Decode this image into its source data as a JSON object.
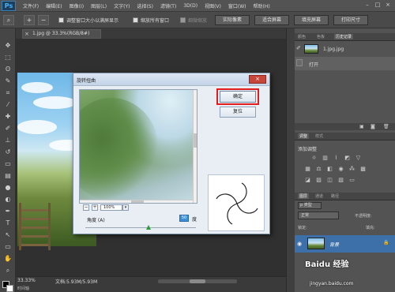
{
  "app": {
    "logo": "Ps"
  },
  "menubar": {
    "items": [
      "文件(F)",
      "编辑(E)",
      "图像(I)",
      "图层(L)",
      "文字(Y)",
      "选择(S)",
      "滤镜(T)",
      "3D(D)",
      "视图(V)",
      "窗口(W)",
      "帮助(H)"
    ],
    "window_controls": [
      "–",
      "□",
      "×"
    ]
  },
  "optionsbar": {
    "resize_windows_label": "调整窗口大小以满屏显示",
    "zoom_all_label": "缩放所有窗口",
    "scrubby_zoom_label": "细微缩放",
    "actual_pixels_label": "实际像素",
    "fit_screen_label": "适合屏幕",
    "fill_screen_label": "填充屏幕",
    "print_size_label": "打印尺寸"
  },
  "document": {
    "tab_title": "1.jpg @ 33.3%(RGB/8#)",
    "zoom": "33.33%",
    "doc_info": "文档:5.93M/5.93M",
    "timeline_label": "时间轴"
  },
  "dialog": {
    "title": "旋转扭曲",
    "ok_label": "确定",
    "reset_label": "复位",
    "preview_zoom": "100%",
    "zoom_out": "−",
    "zoom_in": "+",
    "angle_label": "角度 (A)",
    "angle_value": "50",
    "angle_unit": "度",
    "angle_fraction": 0.57,
    "close_label": "×"
  },
  "panels": {
    "top_tabs": [
      "颜色",
      "色板",
      "历史记录"
    ],
    "history_items": [
      {
        "label": "1.jpg.jpg"
      },
      {
        "label": "打开"
      }
    ],
    "adjust_tabs": [
      "调整",
      "样式"
    ],
    "adjust_title": "添加调整",
    "layer_tabs": [
      "图层",
      "通道",
      "路径"
    ],
    "type_select": "p 类型",
    "blend_mode": "正常",
    "opacity_label": "不透明度:",
    "lock_label": "锁定:",
    "fill_label": "填充:",
    "layer_name": "背景"
  },
  "watermark": {
    "brand": "Baidu 经验",
    "url": "jingyan.baidu.com"
  },
  "colors": {
    "highlight": "#e21c1c",
    "layer_selected": "#3d6fa8",
    "angle_input": "#3d8fd6"
  }
}
